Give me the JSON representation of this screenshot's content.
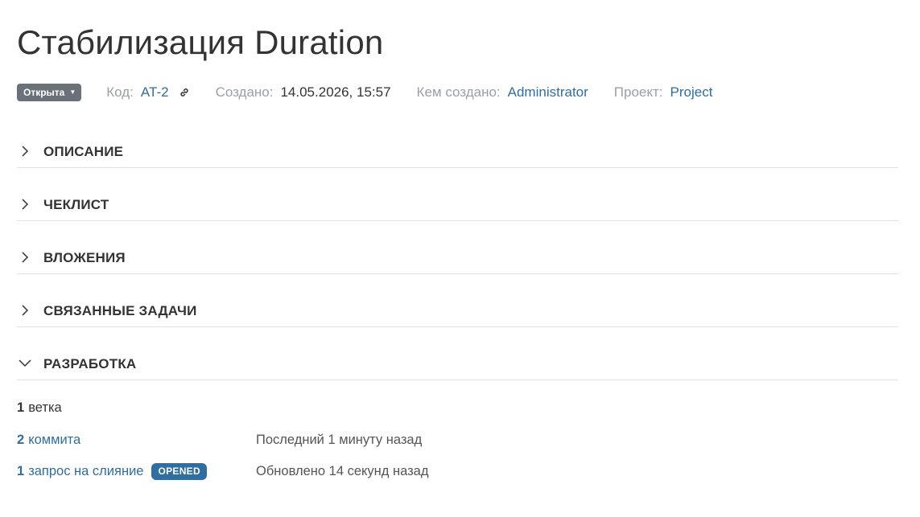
{
  "issue": {
    "title": "Стабилизация Duration",
    "status": "Открыта",
    "code_label": "Код:",
    "code": "AT-2",
    "created_label": "Создано:",
    "created": "14.05.2026, 15:57",
    "author_label": "Кем создано:",
    "author": "Administrator",
    "project_label": "Проект:",
    "project": "Project"
  },
  "sections": [
    {
      "label": "ОПИСАНИЕ",
      "expanded": false
    },
    {
      "label": "ЧЕКЛИСТ",
      "expanded": false
    },
    {
      "label": "ВЛОЖЕНИЯ",
      "expanded": false
    },
    {
      "label": "СВЯЗАННЫЕ ЗАДАЧИ",
      "expanded": false
    },
    {
      "label": "РАЗРАБОТКА",
      "expanded": true
    }
  ],
  "development": {
    "branches": {
      "count": "1",
      "label": "ветка"
    },
    "commits": {
      "count": "2",
      "label": "коммита",
      "info": "Последний 1 минуту назад"
    },
    "merge_requests": {
      "count": "1",
      "label": "запрос на слияние",
      "badge": "OPENED",
      "info": "Обновлено 14 секунд назад"
    }
  },
  "colors": {
    "link": "#2f6ea3",
    "status_badge": "#6b7178",
    "opened_badge": "#2f6ea3"
  }
}
